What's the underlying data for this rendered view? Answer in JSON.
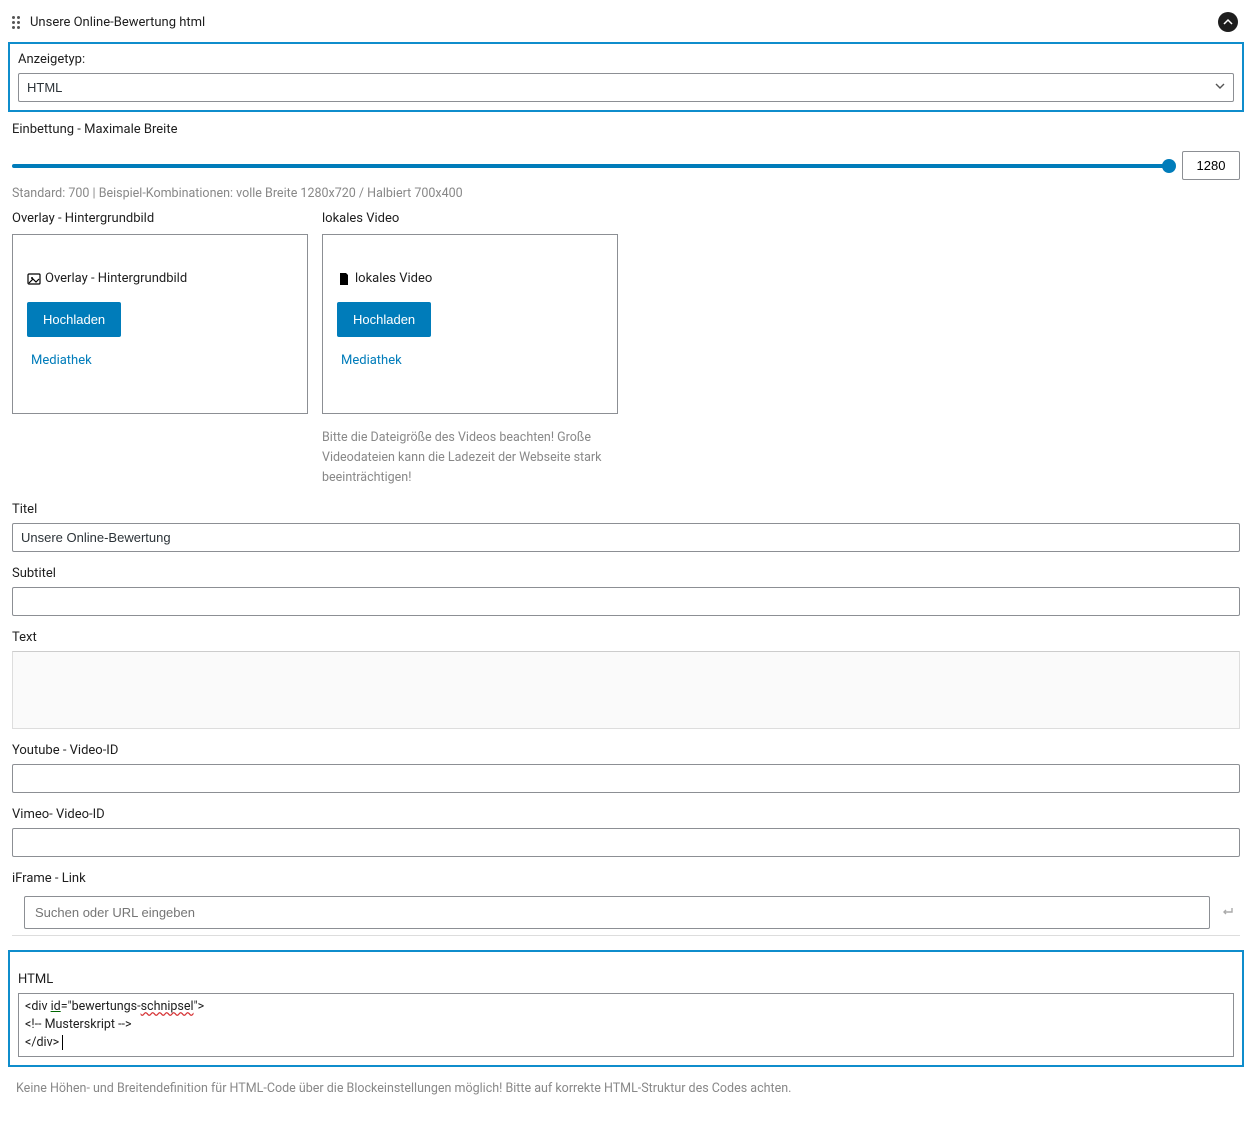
{
  "header": {
    "title": "Unsere Online-Bewertung html"
  },
  "anzeigetyp": {
    "label": "Anzeigetyp:",
    "value": "HTML"
  },
  "einbettung": {
    "label": "Einbettung - Maximale Breite",
    "value": "1280",
    "help": "Standard: 700 | Beispiel-Kombinationen: volle Breite 1280x720 / Halbiert 700x400"
  },
  "overlay": {
    "section_label": "Overlay - Hintergrundbild",
    "card_title": "Overlay - Hintergrundbild",
    "upload_label": "Hochladen",
    "media_label": "Mediathek"
  },
  "video": {
    "section_label": "lokales Video",
    "card_title": "lokales Video",
    "upload_label": "Hochladen",
    "media_label": "Mediathek",
    "note": "Bitte die Dateigröße des Videos beachten! Große Videodateien kann die Ladezeit der Webseite stark beeinträchtigen!"
  },
  "titel": {
    "label": "Titel",
    "value": "Unsere Online-Bewertung"
  },
  "subtitel": {
    "label": "Subtitel",
    "value": ""
  },
  "text": {
    "label": "Text",
    "value": ""
  },
  "youtube": {
    "label": "Youtube - Video-ID",
    "value": ""
  },
  "vimeo": {
    "label": "Vimeo- Video-ID",
    "value": ""
  },
  "iframe": {
    "label": "iFrame - Link",
    "placeholder": "Suchen oder URL eingeben"
  },
  "html": {
    "label": "HTML",
    "code_line1_a": "<div ",
    "code_line1_b": "id",
    "code_line1_c": "=\"bewertungs-",
    "code_line1_d": "schnipsel",
    "code_line1_e": "\">",
    "code_line2": "<!-- Musterskript -->",
    "code_line3": "</div>"
  },
  "bottom_note": "Keine Höhen- und Breitendefinition für HTML-Code über die Blockeinstellungen möglich! Bitte auf korrekte HTML-Struktur des Codes achten."
}
